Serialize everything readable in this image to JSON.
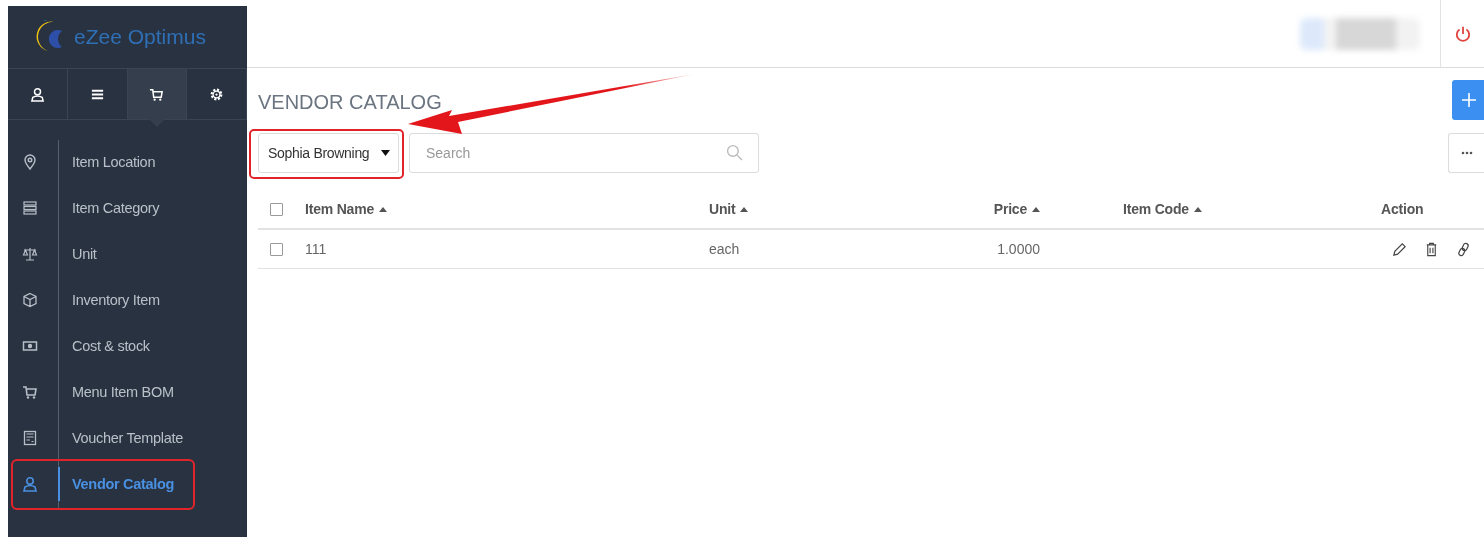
{
  "app": {
    "logo_text": "eZee Optimus"
  },
  "sidebar_tabs": [
    {
      "kind": "user",
      "selected": false
    },
    {
      "kind": "list",
      "selected": false
    },
    {
      "kind": "cart",
      "selected": true
    },
    {
      "kind": "settings",
      "selected": false
    }
  ],
  "sidebar": {
    "items": [
      {
        "label": "Item Location",
        "kind": "pin",
        "selected": false
      },
      {
        "label": "Item Category",
        "kind": "stack",
        "selected": false
      },
      {
        "label": "Unit",
        "kind": "scale",
        "selected": false
      },
      {
        "label": "Inventory Item",
        "kind": "box",
        "selected": false
      },
      {
        "label": "Cost & stock",
        "kind": "money",
        "selected": false
      },
      {
        "label": "Menu Item BOM",
        "kind": "cart",
        "selected": false
      },
      {
        "label": "Voucher Template",
        "kind": "voucher",
        "selected": false
      },
      {
        "label": "Vendor Catalog",
        "kind": "user",
        "selected": true
      }
    ]
  },
  "page": {
    "title": "VENDOR CATALOG",
    "vendor_dropdown": {
      "value": "Sophia Browning"
    },
    "search": {
      "placeholder": "Search"
    }
  },
  "table": {
    "select_all_checked": false,
    "columns": [
      {
        "label": "Item Name",
        "sortable": true
      },
      {
        "label": "Unit",
        "sortable": true
      },
      {
        "label": "Price",
        "sortable": true
      },
      {
        "label": "Item Code",
        "sortable": true
      },
      {
        "label": "Action",
        "sortable": false
      }
    ],
    "rows": [
      {
        "checked": false,
        "cells": [
          "111",
          "each",
          "1.0000",
          ""
        ]
      }
    ]
  }
}
